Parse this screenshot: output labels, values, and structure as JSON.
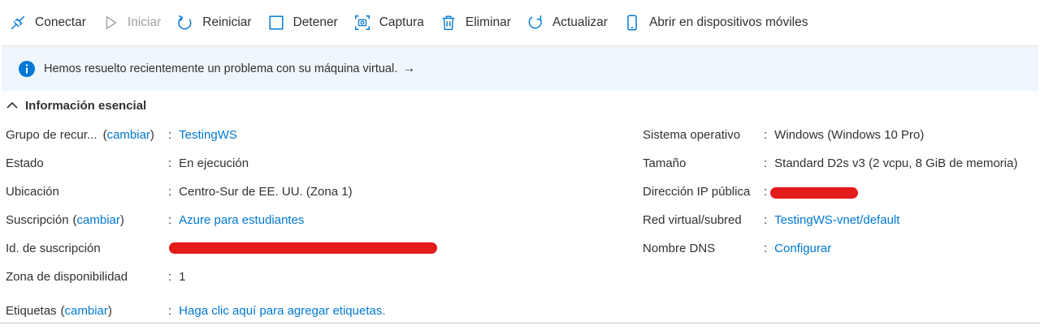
{
  "toolbar": {
    "items": [
      {
        "label": "Conectar",
        "icon": "connect-icon",
        "enabled": true
      },
      {
        "label": "Iniciar",
        "icon": "play-icon",
        "enabled": false
      },
      {
        "label": "Reiniciar",
        "icon": "restart-icon",
        "enabled": true
      },
      {
        "label": "Detener",
        "icon": "stop-icon",
        "enabled": true
      },
      {
        "label": "Captura",
        "icon": "capture-icon",
        "enabled": true
      },
      {
        "label": "Eliminar",
        "icon": "trash-icon",
        "enabled": true
      },
      {
        "label": "Actualizar",
        "icon": "refresh-icon",
        "enabled": true
      },
      {
        "label": "Abrir en dispositivos móviles",
        "icon": "mobile-icon",
        "enabled": true
      }
    ]
  },
  "banner": {
    "message": "Hemos resuelto recientemente un problema con su máquina virtual.",
    "arrow": "→"
  },
  "essentials": {
    "title": "Información esencial",
    "left": {
      "resource_group_label": "Grupo de recur...",
      "resource_group_change": "cambiar",
      "resource_group_value": "TestingWS",
      "status_label": "Estado",
      "status_value": "En ejecución",
      "location_label": "Ubicación",
      "location_value": "Centro-Sur de EE. UU. (Zona 1)",
      "subscription_label": "Suscripción",
      "subscription_change": "cambiar",
      "subscription_value": "Azure para estudiantes",
      "subscription_id_label": "Id. de suscripción",
      "availability_zone_label": "Zona de disponibilidad",
      "availability_zone_value": "1",
      "tags_label": "Etiquetas",
      "tags_change": "cambiar",
      "tags_value": "Haga clic aquí para agregar etiquetas."
    },
    "right": {
      "os_label": "Sistema operativo",
      "os_value": "Windows (Windows 10 Pro)",
      "size_label": "Tamaño",
      "size_value": "Standard D2s v3 (2 vcpu, 8 GiB de memoria)",
      "public_ip_label": "Dirección IP pública",
      "vnet_label": "Red virtual/subred",
      "vnet_value": "TestingWS-vnet/default",
      "dns_label": "Nombre DNS",
      "dns_value": "Configurar"
    }
  },
  "colors": {
    "accent": "#0078d4",
    "banner_bg": "#eff6fc",
    "redaction": "#e41b1b"
  }
}
